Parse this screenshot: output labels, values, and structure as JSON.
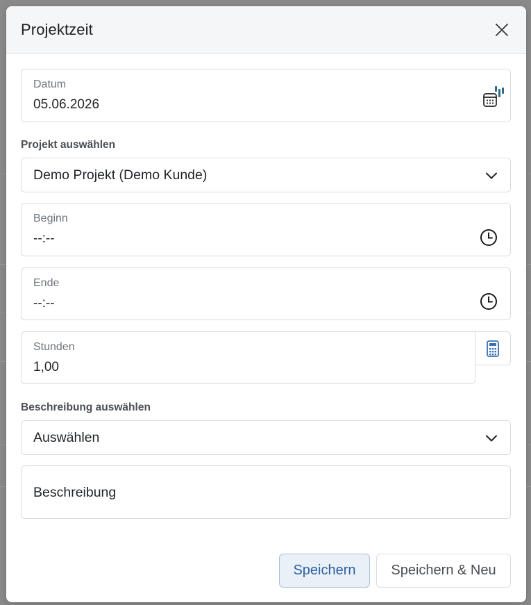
{
  "modal": {
    "title": "Projektzeit"
  },
  "fields": {
    "datum": {
      "label": "Datum",
      "value": "05.06.2026"
    },
    "projekt": {
      "section_label": "Projekt auswählen",
      "selected": "Demo Projekt (Demo Kunde)"
    },
    "beginn": {
      "label": "Beginn",
      "value": "--:--"
    },
    "ende": {
      "label": "Ende",
      "value": "--:--"
    },
    "stunden": {
      "label": "Stunden",
      "value": "1,00"
    },
    "beschreibung_select": {
      "section_label": "Beschreibung auswählen",
      "selected": "Auswählen"
    },
    "beschreibung": {
      "placeholder": "Beschreibung"
    }
  },
  "buttons": {
    "save": "Speichern",
    "save_new": "Speichern & Neu"
  },
  "colors": {
    "accent": "#2f5f9e",
    "calendar_badge": "#2a6b8a",
    "calc_icon": "#3b6fb6"
  },
  "icons": [
    "close-icon",
    "calendar-icon",
    "chevron-down-icon",
    "clock-icon",
    "calculator-icon"
  ]
}
